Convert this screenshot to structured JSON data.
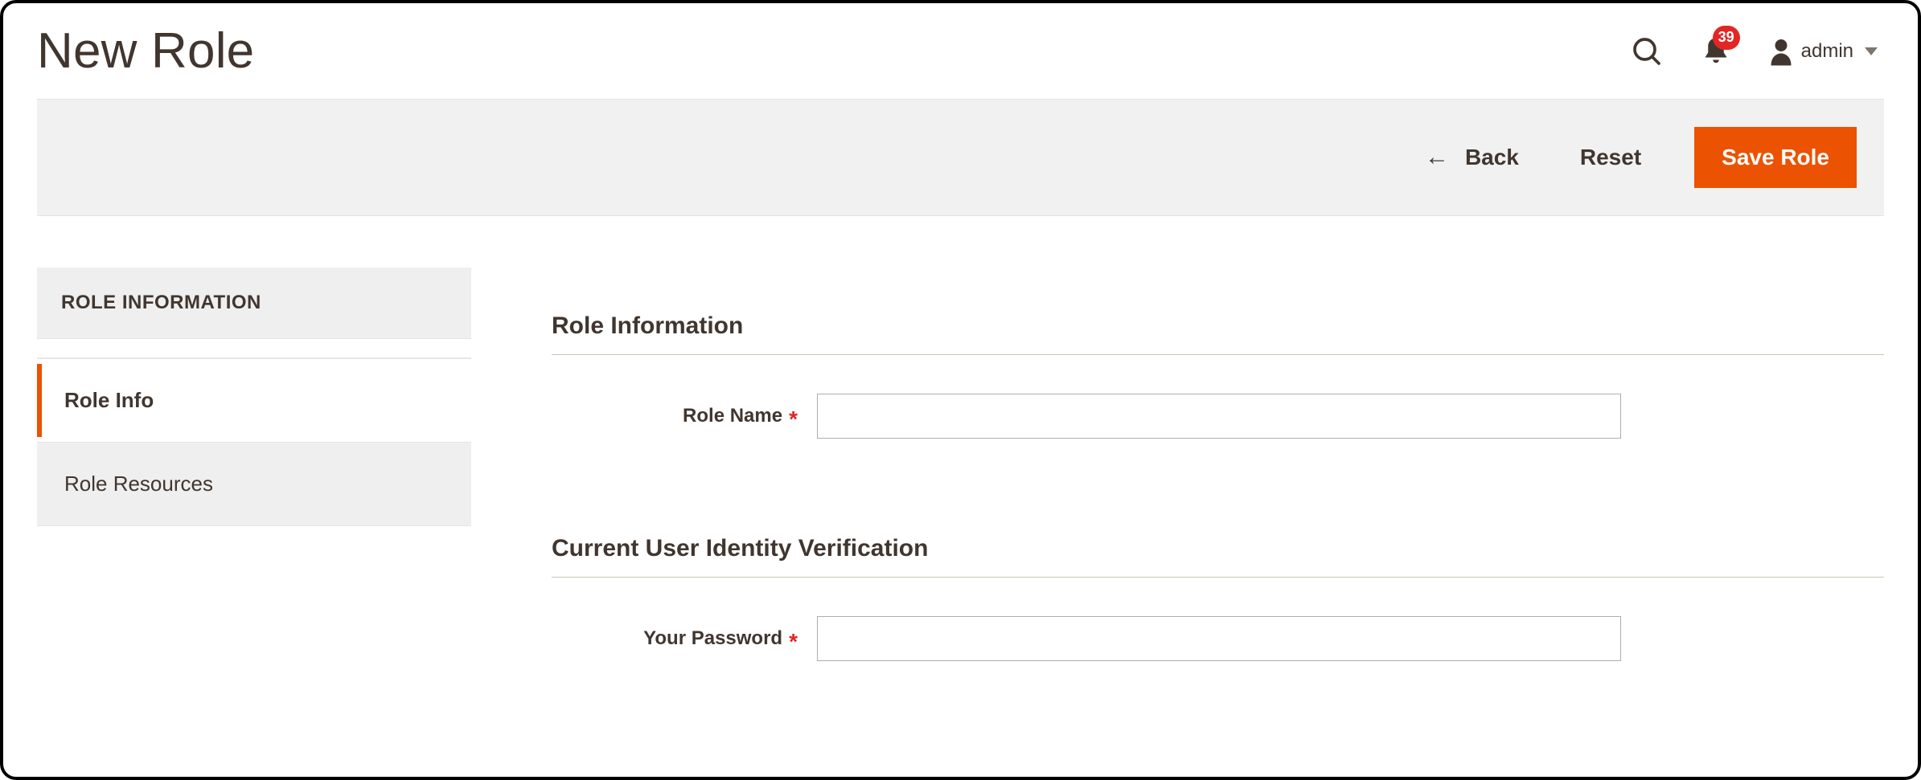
{
  "header": {
    "page_title": "New Role",
    "notification_count": "39",
    "user_name": "admin"
  },
  "actions": {
    "back_label": "Back",
    "reset_label": "Reset",
    "save_label": "Save Role"
  },
  "sidebar": {
    "group_title": "ROLE INFORMATION",
    "tabs": [
      {
        "label": "Role Info",
        "active": true
      },
      {
        "label": "Role Resources",
        "active": false
      }
    ]
  },
  "sections": {
    "role_info": {
      "title": "Role Information",
      "role_name_label": "Role Name",
      "role_name_value": ""
    },
    "verification": {
      "title": "Current User Identity Verification",
      "password_label": "Your Password",
      "password_value": ""
    }
  }
}
